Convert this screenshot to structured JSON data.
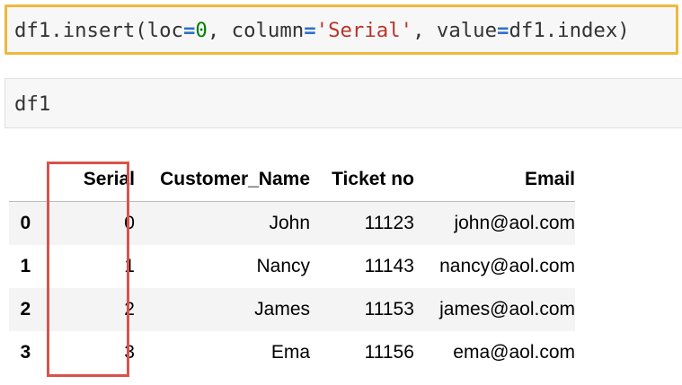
{
  "cell1": {
    "tokens": [
      {
        "text": "df1.insert(loc",
        "kind": "plain"
      },
      {
        "text": "=",
        "kind": "op"
      },
      {
        "text": "0",
        "kind": "num"
      },
      {
        "text": ", column",
        "kind": "plain"
      },
      {
        "text": "=",
        "kind": "op"
      },
      {
        "text": "'Serial'",
        "kind": "str"
      },
      {
        "text": ", value",
        "kind": "plain"
      },
      {
        "text": "=",
        "kind": "op"
      },
      {
        "text": "df1.index)",
        "kind": "plain"
      }
    ],
    "highlight_color": "#f0b83a"
  },
  "cell2": {
    "code": "df1"
  },
  "table": {
    "headers": {
      "index": "",
      "serial": "Serial",
      "name": "Customer_Name",
      "ticket": "Ticket no",
      "email": "Email"
    },
    "rows": [
      {
        "index": "0",
        "serial": "0",
        "name": "John",
        "ticket": "11123",
        "email": "john@aol.com"
      },
      {
        "index": "1",
        "serial": "1",
        "name": "Nancy",
        "ticket": "11143",
        "email": "nancy@aol.com"
      },
      {
        "index": "2",
        "serial": "2",
        "name": "James",
        "ticket": "11153",
        "email": "james@aol.com"
      },
      {
        "index": "3",
        "serial": "3",
        "name": "Ema",
        "ticket": "11156",
        "email": "ema@aol.com"
      }
    ],
    "serial_highlight_color": "#d9534a"
  }
}
